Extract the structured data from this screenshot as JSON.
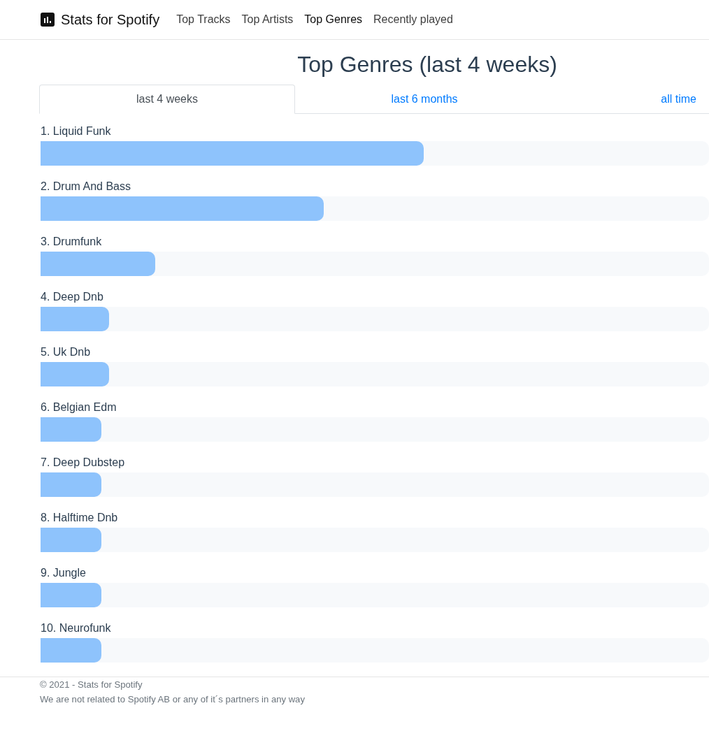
{
  "navbar": {
    "brand": "Stats for Spotify",
    "links": [
      {
        "label": "Top Tracks",
        "selected": false
      },
      {
        "label": "Top Artists",
        "selected": false
      },
      {
        "label": "Top Genres",
        "selected": true
      },
      {
        "label": "Recently played",
        "selected": false
      }
    ]
  },
  "page_title": "Top Genres (last 4 weeks)",
  "period_tabs": [
    {
      "label": "last 4 weeks",
      "selected": true
    },
    {
      "label": "last 6 months",
      "selected": false
    },
    {
      "label": "all time",
      "selected": false
    }
  ],
  "genres": [
    {
      "label": "1. Liquid Funk",
      "level": 0.573
    },
    {
      "label": "2. Drum And Bass",
      "level": 0.424
    },
    {
      "label": "3. Drumfunk",
      "level": 0.172
    },
    {
      "label": "4. Deep Dnb",
      "level": 0.103
    },
    {
      "label": "5. Uk Dnb",
      "level": 0.103
    },
    {
      "label": "6. Belgian Edm",
      "level": 0.091
    },
    {
      "label": "7. Deep Dubstep",
      "level": 0.091
    },
    {
      "label": "8. Halftime Dnb",
      "level": 0.091
    },
    {
      "label": "9. Jungle",
      "level": 0.091
    },
    {
      "label": "10. Neurofunk",
      "level": 0.091
    }
  ],
  "footer": {
    "copyright": "© 2021 - Stats for Spotify",
    "disclaimer": "We are not related to Spotify AB or any of it´s partners in any way"
  }
}
